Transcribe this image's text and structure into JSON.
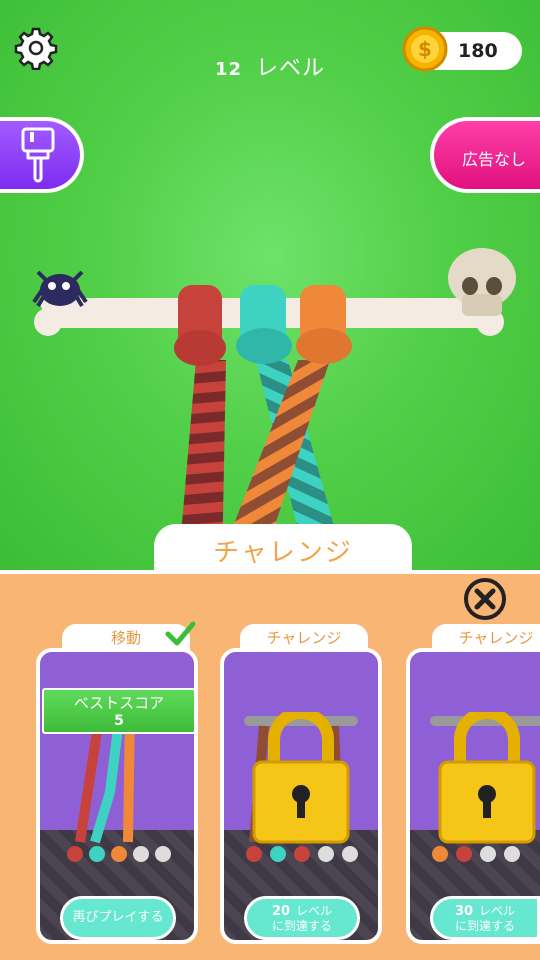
{
  "header": {
    "level_number": "12",
    "level_label": "レベル",
    "coin_count": "180"
  },
  "buttons": {
    "no_ads_label": "広告なし"
  },
  "mode_tab": {
    "label": "チャレンジ"
  },
  "cards": [
    {
      "title": "移動",
      "best_label": "ベストスコア",
      "best_value": "5",
      "action_label": "再びプレイする",
      "completed": true
    },
    {
      "title": "チャレンジ",
      "req_num": "20",
      "req_unit": "レベル",
      "req_text": "に到達する",
      "locked": true
    },
    {
      "title": "チャレンジ",
      "req_num": "30",
      "req_unit": "レベル",
      "req_text": "に到達する",
      "locked": true
    }
  ],
  "icons": {
    "settings": "gear-icon",
    "coin": "coin-icon",
    "skin": "paint-brush-icon",
    "close": "close-icon",
    "check": "check-icon",
    "lock": "lock-icon"
  },
  "colors": {
    "background": "#52cf48",
    "panel": "#f9b574",
    "accent_purple": "#8a3cf5",
    "accent_pink": "#ec1e8f",
    "pill_teal": "#66e8d0",
    "rope_red": "#c8423c",
    "rope_teal": "#3ed2c3",
    "rope_orange": "#f0883a"
  }
}
